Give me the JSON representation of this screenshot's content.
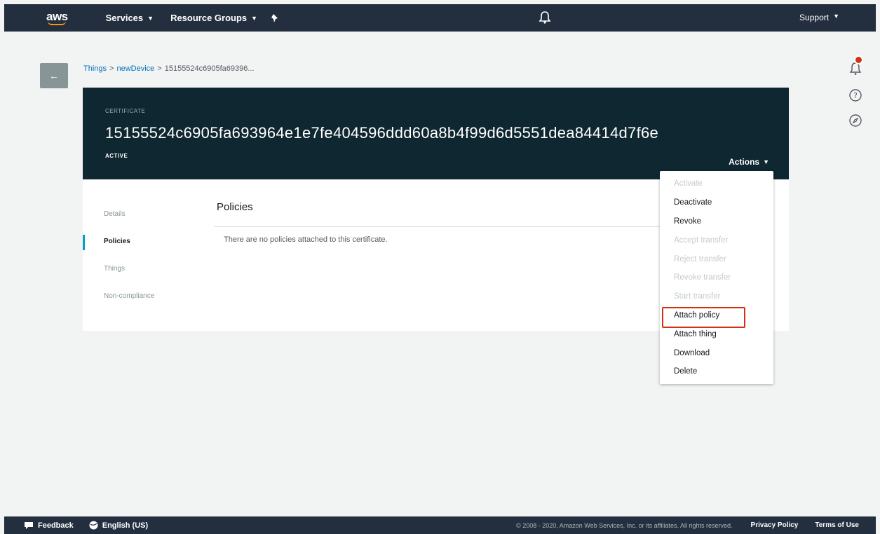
{
  "nav": {
    "logo": "aws",
    "services": "Services",
    "resource_groups": "Resource Groups",
    "support": "Support"
  },
  "breadcrumb": {
    "items": [
      "Things",
      "newDevice",
      "15155524c6905fa69396..."
    ],
    "separator": ">"
  },
  "certificate": {
    "label": "CERTIFICATE",
    "id": "15155524c6905fa693964e1e7fe404596ddd60a8b4f99d6d5551dea84414d7f6e",
    "status": "ACTIVE",
    "actions_label": "Actions"
  },
  "side_nav": {
    "items": [
      "Details",
      "Policies",
      "Things",
      "Non-compliance"
    ],
    "active": "Policies"
  },
  "section": {
    "title": "Policies",
    "empty_message": "There are no policies attached to this certificate."
  },
  "actions_menu": {
    "items": [
      {
        "label": "Activate",
        "disabled": true
      },
      {
        "label": "Deactivate",
        "disabled": false
      },
      {
        "label": "Revoke",
        "disabled": false
      },
      {
        "label": "Accept transfer",
        "disabled": true
      },
      {
        "label": "Reject transfer",
        "disabled": true
      },
      {
        "label": "Revoke transfer",
        "disabled": true
      },
      {
        "label": "Start transfer",
        "disabled": true
      },
      {
        "label": "Attach policy",
        "disabled": false,
        "highlighted": true
      },
      {
        "label": "Attach thing",
        "disabled": false
      },
      {
        "label": "Download",
        "disabled": false
      },
      {
        "label": "Delete",
        "disabled": false
      }
    ]
  },
  "footer": {
    "feedback": "Feedback",
    "language": "English (US)",
    "copyright": "© 2008 - 2020, Amazon Web Services, Inc. or its affiliates. All rights reserved.",
    "privacy": "Privacy Policy",
    "terms": "Terms of Use"
  },
  "icons": {
    "bell": "bell-icon",
    "pin": "pin-icon",
    "back": "arrow-left-icon",
    "notifications": "notification-icon",
    "help": "help-icon",
    "compass": "compass-icon",
    "feedback": "chat-icon",
    "language": "globe-icon"
  },
  "colors": {
    "nav_bg": "#232f3e",
    "header_bg": "#0f2731",
    "accent": "#00a1c9",
    "highlight": "#d13212",
    "link": "#0073bb"
  }
}
